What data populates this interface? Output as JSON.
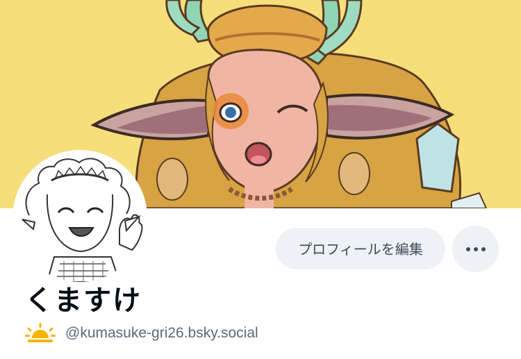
{
  "profile": {
    "display_name": "くますけ",
    "handle": "@kumasuke-gri26.bsky.social",
    "handle_prefix_icon": "sun-icon"
  },
  "actions": {
    "edit_profile_label": "プロフィールを編集",
    "more_icon": "more-dots-icon"
  },
  "banner": {
    "background_color": "#f6de7b",
    "content": "illustration"
  },
  "avatar": {
    "content": "sketch-illustration"
  },
  "colors": {
    "button_bg": "#eef1f5",
    "button_text": "#3f4b5b",
    "name_text": "#0b0f14",
    "handle_text": "#5c6977"
  }
}
